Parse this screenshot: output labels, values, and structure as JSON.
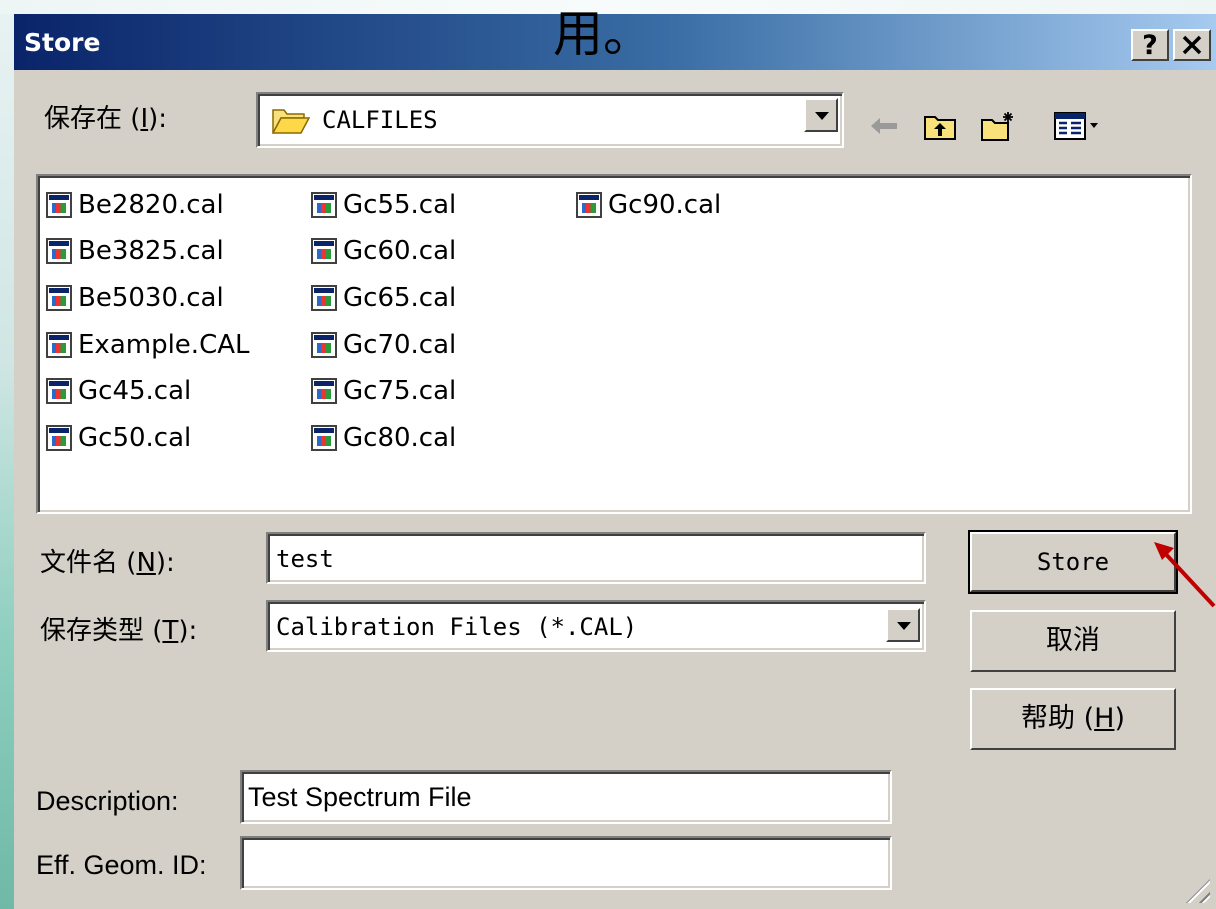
{
  "overlay_caption": "用。",
  "dialog": {
    "title": "Store",
    "help_btn": "?",
    "close_btn": "✕"
  },
  "save_in": {
    "label": "保存在",
    "hotkey": "I",
    "folder": "CALFILES"
  },
  "files": {
    "col1": [
      "Be2820.cal",
      "Be3825.cal",
      "Be5030.cal",
      "Example.CAL",
      "Gc45.cal",
      "Gc50.cal"
    ],
    "col2": [
      "Gc55.cal",
      "Gc60.cal",
      "Gc65.cal",
      "Gc70.cal",
      "Gc75.cal",
      "Gc80.cal"
    ],
    "col3": [
      "Gc90.cal"
    ]
  },
  "filename": {
    "label": "文件名",
    "hotkey": "N",
    "value": "test"
  },
  "filetype": {
    "label": "保存类型",
    "hotkey": "T",
    "value": "Calibration Files (*.CAL)"
  },
  "buttons": {
    "store": "Store",
    "cancel": "取消",
    "help": "帮助",
    "help_hotkey": "H"
  },
  "description": {
    "label": "Description:",
    "value": "Test Spectrum File"
  },
  "eff_geom": {
    "label": "Eff. Geom. ID:",
    "value": ""
  },
  "colors": {
    "title_start": "#0a246a",
    "title_end": "#a6caf0",
    "face": "#d4d0c8",
    "arrow": "#c00000"
  }
}
